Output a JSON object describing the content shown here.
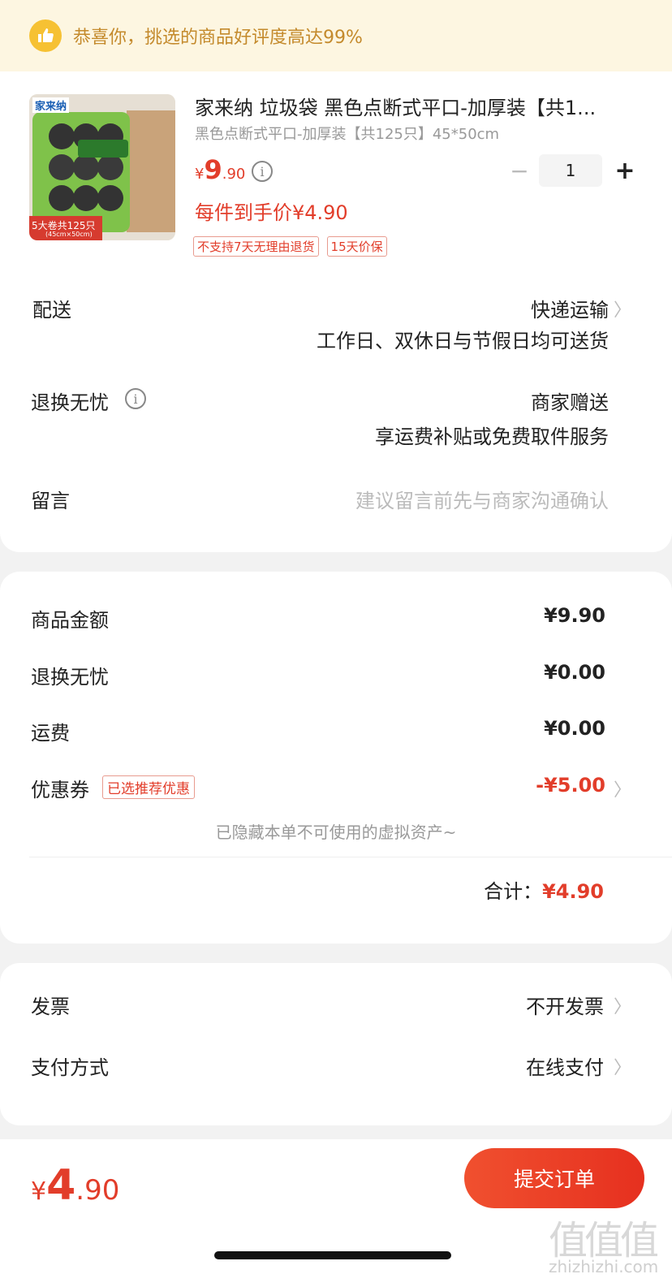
{
  "banner": {
    "icon": "thumbs-up-icon",
    "text": "恭喜你，挑选的商品好评度高达99%",
    "bg_color": "#fdf6e1",
    "text_color": "#c48a2c"
  },
  "product": {
    "image_text_brand": "家来纳",
    "image_text_badge": "5大卷共125只",
    "image_text_size": "(45cm×50cm)",
    "title": "家来纳 垃圾袋 黑色点断式平口-加厚装【共1...",
    "spec": "黑色点断式平口-加厚装【共125只】45*50cm",
    "price_currency": "¥",
    "price_int": "9",
    "price_dec": ".90",
    "unit_price_text": "每件到手价¥4.90",
    "tags": [
      "不支持7天无理由退货",
      "15天价保"
    ],
    "quantity": "1",
    "minus": "−",
    "plus": "+"
  },
  "delivery": {
    "label": "配送",
    "value": "快递运输",
    "sub": "工作日、双休日与节假日均可送货"
  },
  "returns": {
    "label": "退换无忧",
    "value": "商家赠送",
    "sub": "享运费补贴或免费取件服务"
  },
  "message": {
    "label": "留言",
    "placeholder": "建议留言前先与商家沟通确认"
  },
  "summary": {
    "goods_label": "商品金额",
    "goods_value": "¥9.90",
    "returns_label": "退换无忧",
    "returns_value": "¥0.00",
    "shipping_label": "运费",
    "shipping_value": "¥0.00",
    "coupon_label": "优惠券",
    "coupon_tag": "已选推荐优惠",
    "coupon_value": "-¥5.00",
    "hidden_note": "已隐藏本单不可使用的虚拟资产~",
    "total_label": "合计：",
    "total_value": "¥4.90"
  },
  "invoice": {
    "label": "发票",
    "value": "不开发票"
  },
  "payment": {
    "label": "支付方式",
    "value": "在线支付"
  },
  "footer": {
    "total_currency": "¥",
    "total_int": "4",
    "total_dec": ".90",
    "submit_label": "提交订单"
  },
  "watermark": {
    "logo": "值值值",
    "site": "zhizhizhi.com"
  },
  "colors": {
    "accent_red": "#e23d2a",
    "page_bg": "#f2f2f2"
  }
}
